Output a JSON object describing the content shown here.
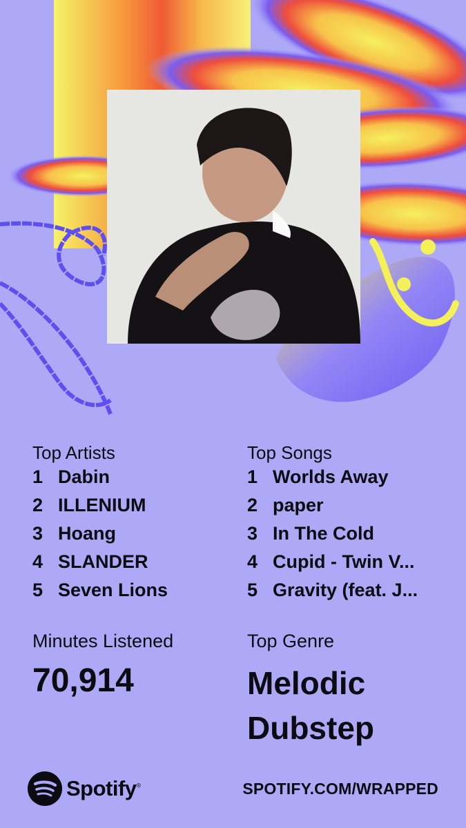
{
  "top_artists": {
    "title": "Top Artists",
    "items": [
      {
        "rank": "1",
        "name": "Dabin"
      },
      {
        "rank": "2",
        "name": "ILLENIUM"
      },
      {
        "rank": "3",
        "name": "Hoang"
      },
      {
        "rank": "4",
        "name": "SLANDER"
      },
      {
        "rank": "5",
        "name": "Seven Lions"
      }
    ]
  },
  "top_songs": {
    "title": "Top Songs",
    "items": [
      {
        "rank": "1",
        "name": "Worlds Away"
      },
      {
        "rank": "2",
        "name": "paper"
      },
      {
        "rank": "3",
        "name": "In The Cold"
      },
      {
        "rank": "4",
        "name": "Cupid - Twin V..."
      },
      {
        "rank": "5",
        "name": "Gravity (feat. J..."
      }
    ]
  },
  "minutes": {
    "label": "Minutes Listened",
    "value": "70,914"
  },
  "genre": {
    "label": "Top Genre",
    "value_line1": "Melodic",
    "value_line2": "Dubstep"
  },
  "footer": {
    "brand": "Spotify",
    "trademark": "®",
    "url": "SPOTIFY.COM/WRAPPED"
  },
  "colors": {
    "background": "#ada9f7",
    "text": "#0c0b12",
    "accent_yellow": "#f3f05a",
    "accent_red": "#ef4a3c",
    "accent_blue": "#6a5cf0"
  },
  "icons": {
    "logo": "spotify-logo-icon"
  }
}
